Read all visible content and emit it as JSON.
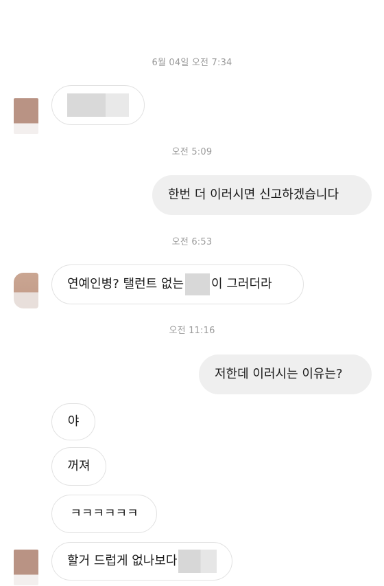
{
  "conversation": {
    "messages": [
      {
        "type": "timestamp",
        "text": "6월 04일 오전 7:34"
      },
      {
        "type": "incoming",
        "text": ""
      },
      {
        "type": "timestamp",
        "text": "오전 5:09"
      },
      {
        "type": "outgoing",
        "text": "한번 더 이러시면 신고하겠습니다"
      },
      {
        "type": "timestamp",
        "text": "오전 6:53"
      },
      {
        "type": "incoming",
        "text_before": "연예인병? 탤런트 없는",
        "text_after": "이 그러더라"
      },
      {
        "type": "timestamp",
        "text": "오전 11:16"
      },
      {
        "type": "outgoing",
        "text": "저한데 이러시는 이유는?"
      },
      {
        "type": "incoming",
        "text": "야"
      },
      {
        "type": "incoming",
        "text": "꺼져"
      },
      {
        "type": "incoming",
        "text": "ㅋㅋㅋㅋㅋㅋ"
      },
      {
        "type": "incoming",
        "text": "할거 드럽게 없나보다"
      }
    ]
  },
  "colors": {
    "incoming_border": "#e1e1e1",
    "outgoing_background": "#efefef",
    "timestamp_text": "#9a9a9a",
    "censor_block": "#d8d8d8"
  }
}
